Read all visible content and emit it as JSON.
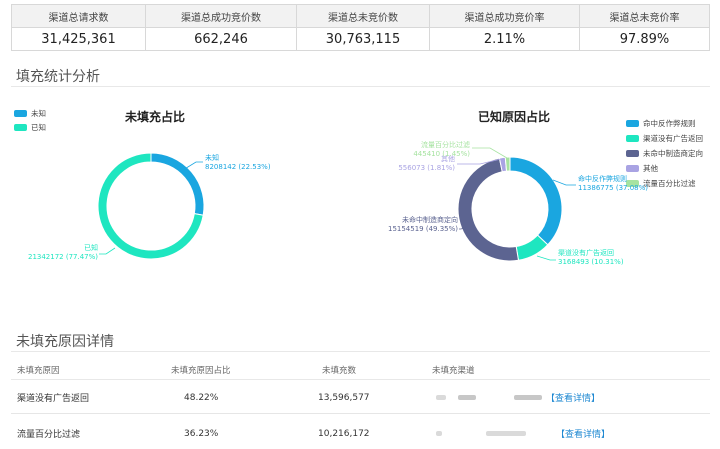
{
  "kpi": {
    "headers": [
      "渠道总请求数",
      "渠道总成功竞价数",
      "渠道总未竞价数",
      "渠道总成功竞价率",
      "渠道总未竞价率"
    ],
    "values": [
      "31,425,361",
      "662,246",
      "30,763,115",
      "2.11%",
      "97.89%"
    ]
  },
  "section_stats": "填充统计分析",
  "section_detail": "未填充原因详情",
  "colors": {
    "blue": "#1aa6e0",
    "teal": "#1ee6c0",
    "slate": "#5c6491",
    "lavender": "#a9a3e3",
    "green": "#a6e3a0"
  },
  "chart_data": [
    {
      "type": "pie",
      "title": "未填充占比",
      "legend_position": "top-left",
      "legend": [
        "未知",
        "已知"
      ],
      "slices": [
        {
          "name": "未知",
          "value": 8208142,
          "pct": "22.53%",
          "label": "未知",
          "value_label": "8208142 (22.53%)"
        },
        {
          "name": "已知",
          "value": 21342172,
          "pct": "77.47%",
          "label": "已知",
          "value_label": "21342172 (77.47%)"
        }
      ]
    },
    {
      "type": "pie",
      "title": "已知原因占比",
      "legend_position": "top-right",
      "legend": [
        "命中反作弊规则",
        "渠道没有广告返回",
        "未命中制造商定向",
        "其他",
        "流量百分比过滤"
      ],
      "slices": [
        {
          "name": "命中反作弊规则",
          "value": 11386775,
          "pct": "37.08%",
          "label": "命中反作弊规则",
          "value_label": "11386775 (37.08%)"
        },
        {
          "name": "渠道没有广告返回",
          "value": 3168493,
          "pct": "10.31%",
          "label": "渠道没有广告返回",
          "value_label": "3168493 (10.31%)"
        },
        {
          "name": "未命中制造商定向",
          "value": 15154519,
          "pct": "49.35%",
          "label": "未命中制造商定向",
          "value_label": "15154519 (49.35%)"
        },
        {
          "name": "其他",
          "value": 556073,
          "pct": "1.81%",
          "label": "其他",
          "value_label": "556073 (1.81%)"
        },
        {
          "name": "流量百分比过滤",
          "value": 445410,
          "pct": "1.45%",
          "label": "流量百分比过滤",
          "value_label": "445410 (1.45%)"
        }
      ]
    }
  ],
  "detail_table": {
    "headers": [
      "未填充原因",
      "未填充原因占比",
      "未填充数",
      "未填充渠道"
    ],
    "rows": [
      {
        "reason": "渠道没有广告返回",
        "pct": "48.22%",
        "count": "13,596,577",
        "link": "【查看详情】"
      },
      {
        "reason": "流量百分比过滤",
        "pct": "36.23%",
        "count": "10,216,172",
        "link": "【查看详情】"
      }
    ]
  }
}
